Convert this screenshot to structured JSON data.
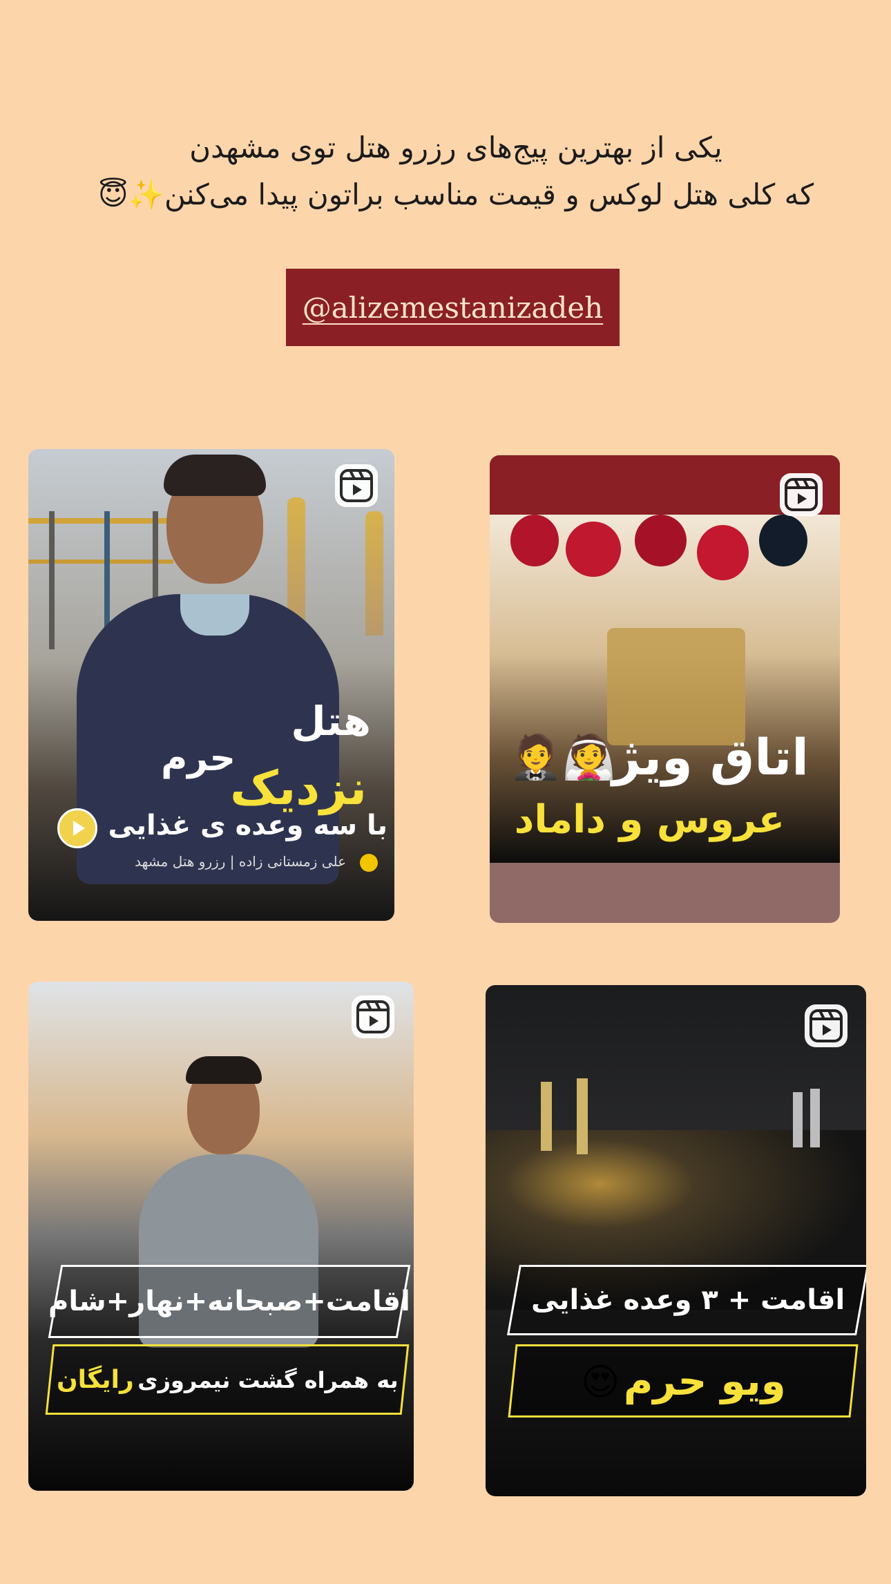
{
  "story": {
    "caption_line1": "یکی از بهترین پیج‌های رزرو هتل توی مشهدن",
    "caption_line2": "که کلی هتل لوکس و قیمت مناسب براتون پیدا می‌کنن✨😇",
    "mention": "@alizemestanizadeh"
  },
  "posts": [
    {
      "title_line1": "هتل",
      "title_line2": "نزدیک",
      "title_word": "حرم",
      "subtitle": "با سه وعده ی غذایی",
      "footer": "علی زمستانی زاده | رزرو هتل مشهد"
    },
    {
      "title": "اتاق ویژه",
      "subtitle": "عروس و داماد",
      "emoji": "👰🤵"
    },
    {
      "banner1": "اقامت+صبحانه+نهار+شام",
      "banner2_prefix": "به همراه گشت نیمروزی",
      "banner2_highlight": "رایگان"
    },
    {
      "banner1": "اقامت + ۳ وعده غذایی",
      "banner2": "ویو حرم",
      "emoji": "😍"
    }
  ],
  "colors": {
    "background": "#fdd5ab",
    "mention_bg": "#8a1f26",
    "accent_yellow": "#f7e13a"
  },
  "icons": [
    "reels-icon",
    "play-circle-icon",
    "sun-badge-icon"
  ]
}
